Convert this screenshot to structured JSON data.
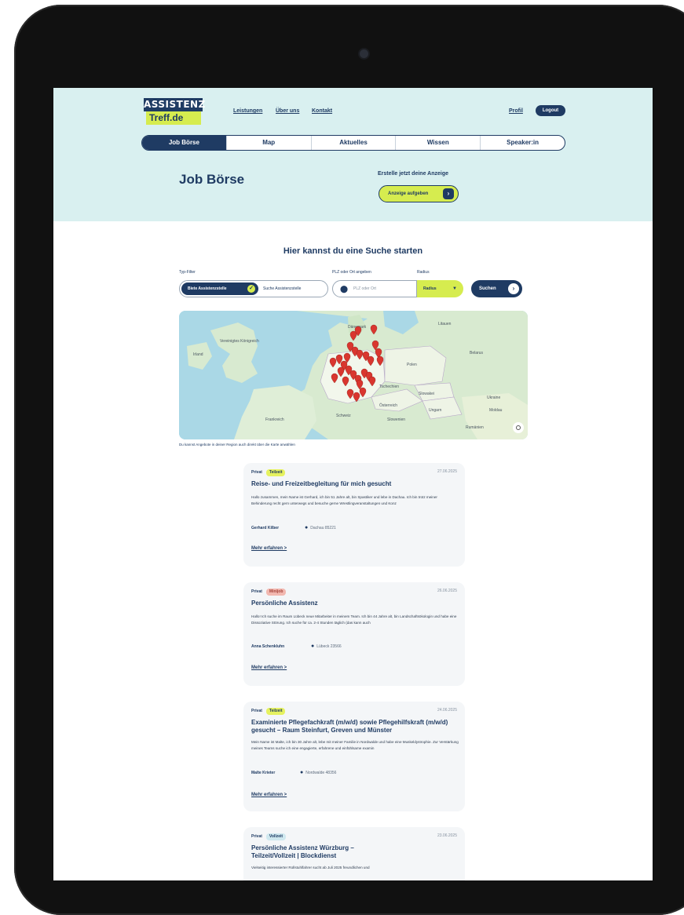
{
  "header": {
    "logo_top": "ASSISTENZ",
    "logo_bottom": "Treff.de",
    "nav": [
      "Leistungen",
      "Über uns",
      "Kontakt"
    ],
    "profil": "Profil",
    "logout": "Logout"
  },
  "tabs": [
    "Job Börse",
    "Map",
    "Aktuelles",
    "Wissen",
    "Speaker:in"
  ],
  "hero": {
    "title": "Job Börse",
    "create_label": "Erstelle jetzt deine Anzeige",
    "create_button": "Anzeige aufgeben"
  },
  "search": {
    "title": "Hier kannst du eine Suche starten",
    "type_label": "Typ-Filter",
    "type_option_active": "Biete Assistenzstelle",
    "type_option_inactive": "Suche Assistenzstelle",
    "plz_label": "PLZ oder Ort angeben",
    "plz_placeholder": "PLZ oder Ort",
    "radius_label": "Radius",
    "radius_value": "Radius",
    "submit": "Suchen"
  },
  "map": {
    "caption": "Du kannst Angebote in deiner Region auch direkt über die Karte anwählen",
    "labels": [
      "Dänemark",
      "Litauen",
      "Vereinigtes Königreich",
      "Irland",
      "Polen",
      "Belarus",
      "Tschechien",
      "Slowakei",
      "Frankreich",
      "Österreich",
      "Ungarn",
      "Ukraine",
      "Schweiz",
      "Moldau",
      "Rumänien",
      "Slowenien"
    ]
  },
  "cards": [
    {
      "type": "Privat",
      "badge": "Teilzeit",
      "date": "27.06.2025",
      "title": "Reise- und Freizeitbegleitung für mich gesucht",
      "description": "Hallo zusammen, mein Name ist Gerhard, ich bin 51 Jahre alt, bin Spastiker und lebe in Dachau. Ich bin trotz meiner Behinderung recht gern unterwegs und besuche gerne Wrestlingveranstaltungen und Konz",
      "person": "Gerhard Kilber",
      "location": "Dachau 85221",
      "more": "Mehr erfahren >"
    },
    {
      "type": "Privat",
      "badge": "Minijob",
      "date": "26.06.2025",
      "title": "Persönliche Assistenz",
      "description": "Hallo! Ich suche im Raum Lübeck neue Mitarbeiter in meinem Team. Ich bin 44 Jahre alt, bin Landschaftsökologin und habe eine Dissoziative Störung. Ich suche für ca. 2-4 Stunden täglich (das kann auch",
      "person": "Anna Schenkluhn",
      "location": "Lübeck 23566",
      "more": "Mehr erfahren >"
    },
    {
      "type": "Privat",
      "badge": "Teilzeit",
      "date": "24.06.2025",
      "title": "Examinierte Pflegefachkraft (m/w/d) sowie Pflegehilfskraft (m/w/d) gesucht – Raum Steinfurt, Greven und Münster",
      "description": "Mein Name ist Malte, ich bin 30 Jahre alt, lebe mit meiner Familie in Nordwalde und habe eine Muskeldystrophie. Zur Verstärkung meines Teams suche ich eine engagierte, erfahrene und einfühlsame examin",
      "person": "Malte Krieter",
      "location": "Nordwalde 48356",
      "more": "Mehr erfahren >"
    },
    {
      "type": "Privat",
      "badge": "Vollzeit",
      "date": "23.06.2025",
      "title": "Persönliche Assistenz Würzburg – Teilzeit/Vollzeit | Blockdienst",
      "description": "Vielseitig interessierter Rollstuhlfahrer sucht ab Juli 2025 freundlichen und",
      "person": "",
      "location": "",
      "more": ""
    }
  ],
  "colors": {
    "navy": "#1f3b63",
    "lime": "#d6ec4f",
    "mint": "#d9f0f0"
  }
}
